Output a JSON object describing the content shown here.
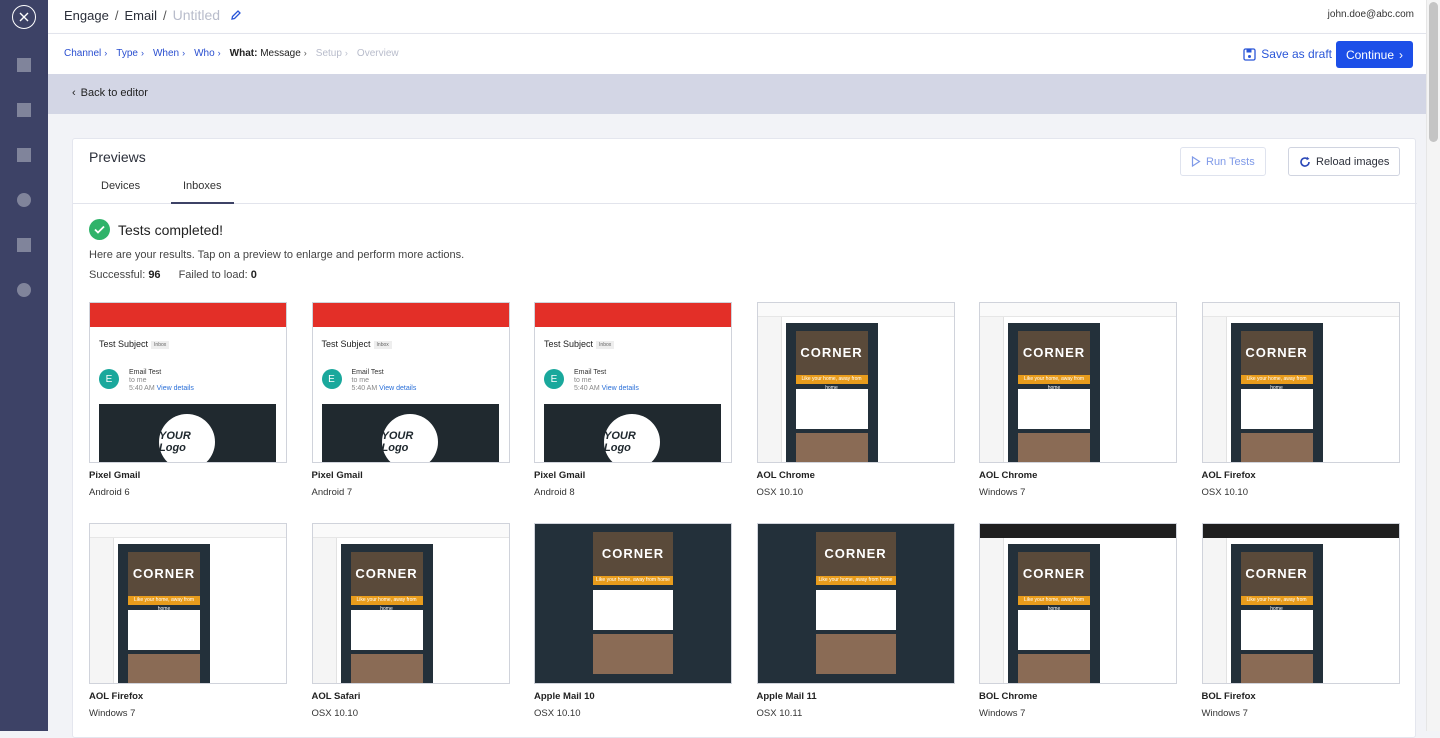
{
  "breadcrumb": {
    "root": "Engage",
    "section": "Email",
    "title": "Untitled"
  },
  "user": {
    "email": "john.doe@abc.com"
  },
  "steps": [
    {
      "label": "Channel"
    },
    {
      "label": "Type"
    },
    {
      "label": "When"
    },
    {
      "label": "Who"
    }
  ],
  "current_step": {
    "key": "What:",
    "value": "Message"
  },
  "pending_steps": [
    {
      "label": "Setup"
    },
    {
      "label": "Overview"
    }
  ],
  "actions": {
    "save_draft": "Save as draft",
    "continue": "Continue"
  },
  "back": {
    "label": "Back to editor"
  },
  "previews": {
    "title": "Previews",
    "tabs": [
      {
        "label": "Devices"
      },
      {
        "label": "Inboxes"
      }
    ],
    "run_tests": "Run Tests",
    "reload_images": "Reload images",
    "status": "Tests completed!",
    "note": "Here are your results. Tap on a preview to enlarge and perform more actions.",
    "successful_label": "Successful:",
    "successful_count": "96",
    "failed_label": "Failed to load:",
    "failed_count": "0"
  },
  "gmail_preview": {
    "subject": "Test Subject",
    "badge": "Inbox",
    "avatar": "E",
    "from": "Email Test",
    "to": "to me",
    "time": "5:40 AM",
    "details": "View details",
    "logo": "YOUR Logo"
  },
  "newsletter_preview": {
    "headline": "CORNER",
    "tagline": "Like your home, away from home"
  },
  "clients": [
    {
      "name": "Pixel Gmail",
      "os": "Android 6",
      "kind": "gmail"
    },
    {
      "name": "Pixel Gmail",
      "os": "Android 7",
      "kind": "gmail"
    },
    {
      "name": "Pixel Gmail",
      "os": "Android 8",
      "kind": "gmail"
    },
    {
      "name": "AOL Chrome",
      "os": "OSX 10.10",
      "kind": "web"
    },
    {
      "name": "AOL Chrome",
      "os": "Windows 7",
      "kind": "web"
    },
    {
      "name": "AOL Firefox",
      "os": "OSX 10.10",
      "kind": "web"
    },
    {
      "name": "AOL Firefox",
      "os": "Windows 7",
      "kind": "web"
    },
    {
      "name": "AOL Safari",
      "os": "OSX 10.10",
      "kind": "web"
    },
    {
      "name": "Apple Mail 10",
      "os": "OSX 10.10",
      "kind": "dark"
    },
    {
      "name": "Apple Mail 11",
      "os": "OSX 10.11",
      "kind": "dark"
    },
    {
      "name": "BOL Chrome",
      "os": "Windows 7",
      "kind": "bol"
    },
    {
      "name": "BOL Firefox",
      "os": "Windows 7",
      "kind": "bol"
    }
  ]
}
